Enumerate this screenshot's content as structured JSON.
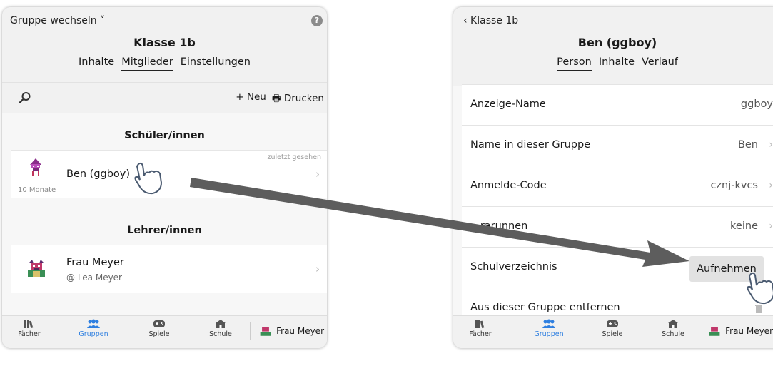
{
  "left": {
    "switch_label": "Gruppe wechseln ˅",
    "help_label": "?",
    "title": "Klasse 1b",
    "tabs": [
      {
        "label": "Inhalte"
      },
      {
        "label": "Mitglieder",
        "active": true
      },
      {
        "label": "Einstellungen"
      }
    ],
    "new_label": "+ Neu",
    "print_label": "🖶 Drucken",
    "students_title": "Schüler/innen",
    "student": {
      "name": "Ben (ggboy)",
      "age": "10 Monate",
      "seen": "zuletzt gesehen"
    },
    "teachers_title": "Lehrer/innen",
    "teacher": {
      "name": "Frau Meyer",
      "sub": "@ Lea Meyer"
    }
  },
  "right": {
    "back_label": "‹ Klasse 1b",
    "title": "Ben (ggboy)",
    "tabs": [
      {
        "label": "Person",
        "active": true
      },
      {
        "label": "Inhalte"
      },
      {
        "label": "Verlauf"
      }
    ],
    "rows": [
      {
        "label": "Anzeige-Name",
        "value": "ggboy"
      },
      {
        "label": "Name in dieser Gruppe",
        "value": "Ben"
      },
      {
        "label": "Anmelde-Code",
        "value": "cznj-kvcs"
      },
      {
        "label": "...rarunnen",
        "value": "keine"
      },
      {
        "label": "Schulverzeichnis",
        "button": "Aufnehmen"
      },
      {
        "label": "Aus dieser Gruppe entfernen"
      }
    ]
  },
  "tabbar": {
    "items": [
      "Fächer",
      "Gruppen",
      "Spiele",
      "Schule"
    ],
    "user": "Frau Meyer"
  },
  "colors": {
    "accent": "#2e7fe0",
    "arrow": "#5d5d5d"
  }
}
